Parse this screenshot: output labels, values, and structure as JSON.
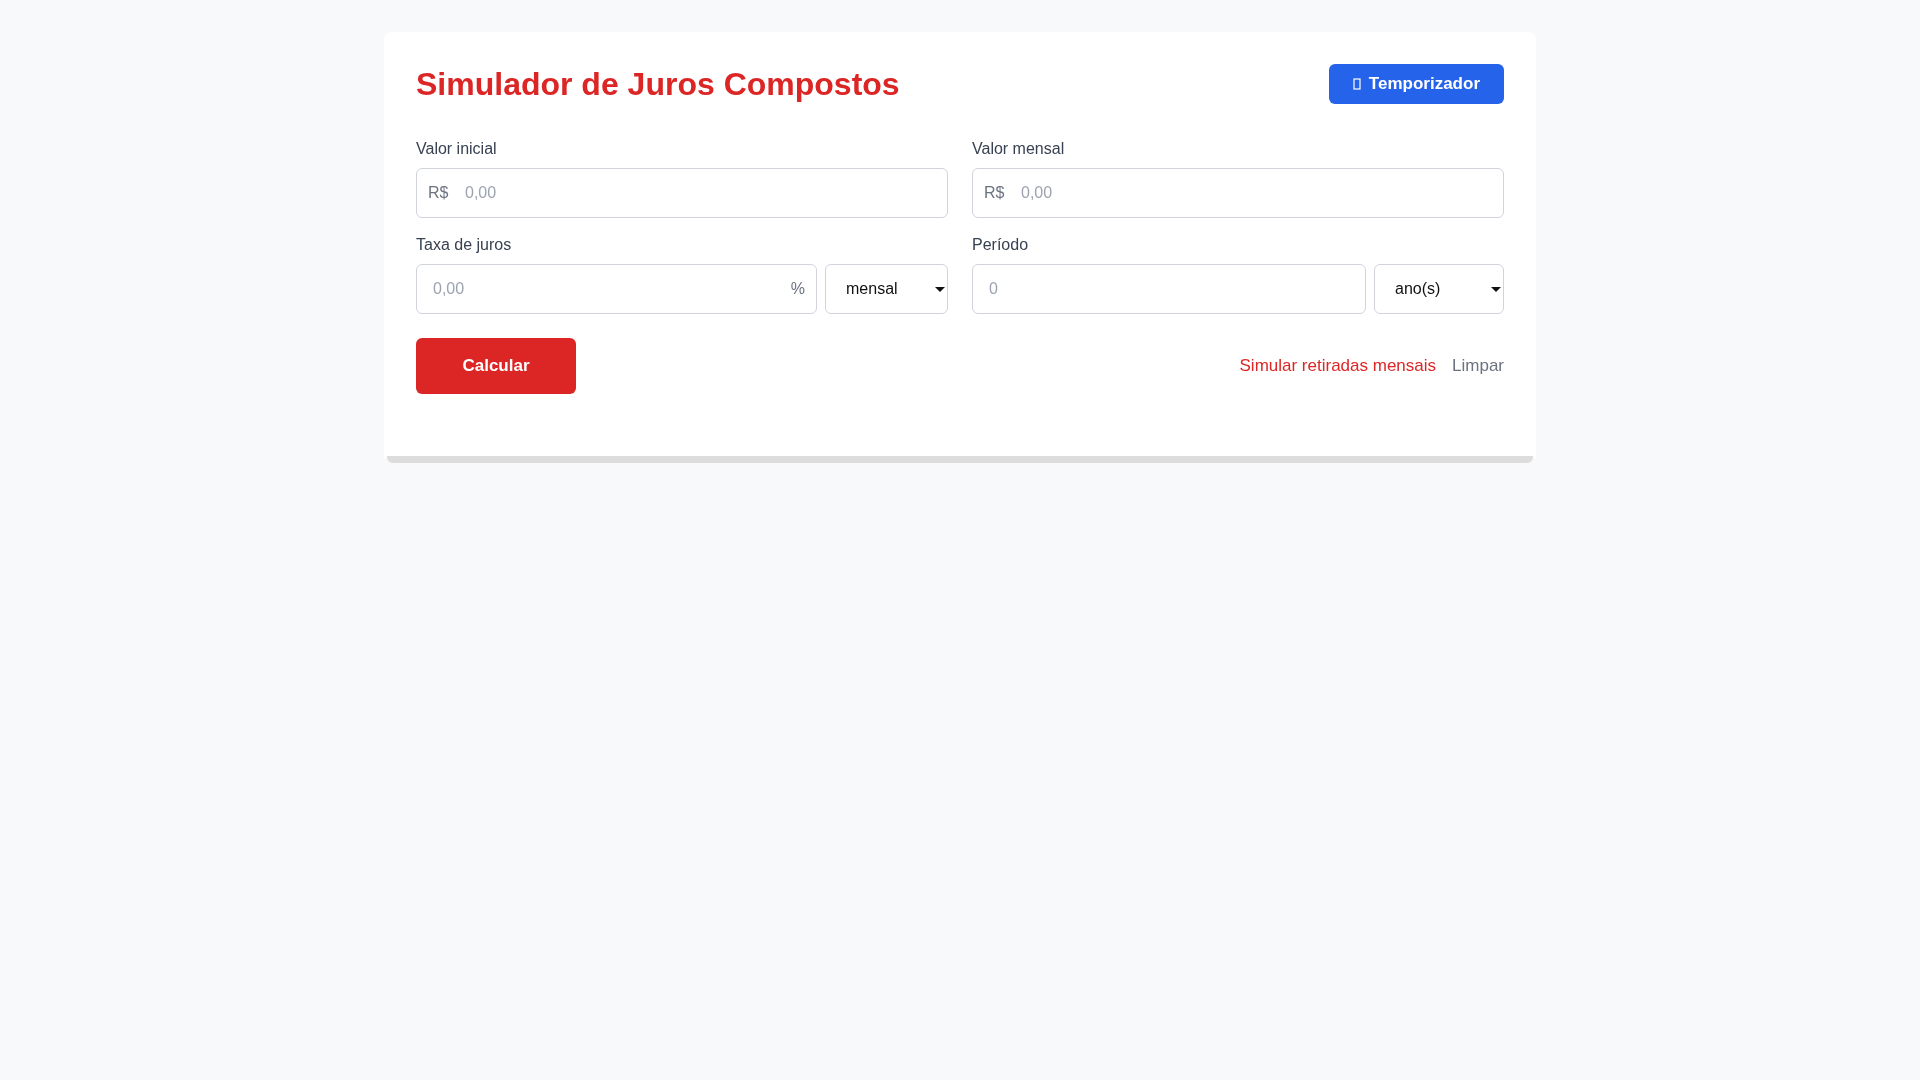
{
  "title": "Simulador de Juros Compostos",
  "timer_button": {
    "label": "Temporizador"
  },
  "fields": [
    {
      "label": "Valor inicial",
      "prefix": "R$",
      "placeholder": "0,00"
    },
    {
      "label": "Valor mensal",
      "prefix": "R$",
      "placeholder": "0,00"
    },
    {
      "label": "Taxa de juros",
      "suffix": "%",
      "placeholder": "0,00",
      "unit": "mensal"
    },
    {
      "label": "Período",
      "placeholder": "0",
      "unit": "ano(s)"
    }
  ],
  "calculate_button": {
    "label": "Calcular"
  },
  "links": [
    {
      "label": "Simular retiradas mensais",
      "kind": "primary"
    },
    {
      "label": "Limpar",
      "kind": "muted"
    }
  ]
}
